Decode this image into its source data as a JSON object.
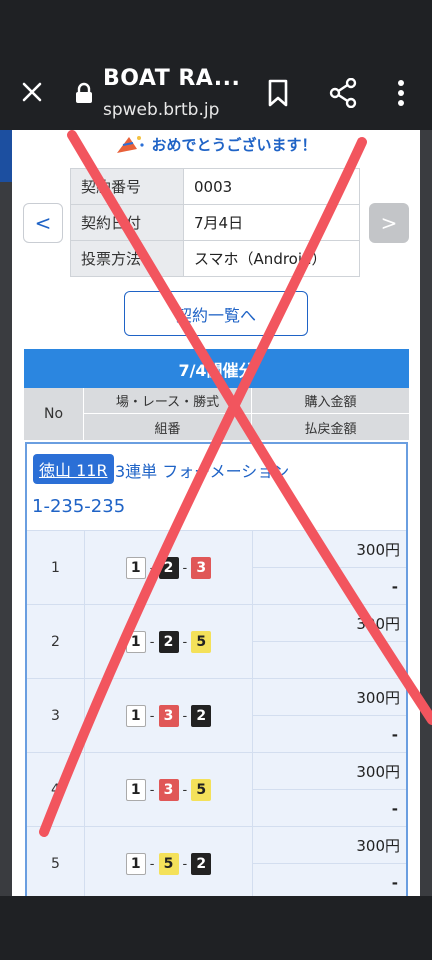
{
  "browser": {
    "title": "BOAT RA...",
    "url": "spweb.brtb.jp",
    "icons": [
      "close-icon",
      "lock-icon",
      "bookmark-icon",
      "share-icon",
      "more-vert-icon"
    ]
  },
  "congrats_text": "おめでとうございます！",
  "contract": {
    "rows": [
      {
        "label": "契約番号",
        "value": "0003"
      },
      {
        "label": "契約日付",
        "value": "7月4日"
      },
      {
        "label": "投票方法",
        "value": "スマホ（Android）"
      }
    ],
    "prev_label": "<",
    "next_label": ">"
  },
  "contract_list_button": "契約一覧へ",
  "day_header": "7/4開催分",
  "columns": {
    "no": "No",
    "race_info": "場・レース・勝式",
    "combo": "組番",
    "purchase": "購入金額",
    "payout": "払戻金額"
  },
  "race": {
    "tag": "徳山 11R",
    "bet_type": "3連単 フォーメーション",
    "formation": "1-235-235"
  },
  "bets": [
    {
      "no": "1",
      "boats": [
        "1",
        "2",
        "3"
      ],
      "amount": "300円",
      "payout": "-"
    },
    {
      "no": "2",
      "boats": [
        "1",
        "2",
        "5"
      ],
      "amount": "300円",
      "payout": "-"
    },
    {
      "no": "3",
      "boats": [
        "1",
        "3",
        "2"
      ],
      "amount": "300円",
      "payout": "-"
    },
    {
      "no": "4",
      "boats": [
        "1",
        "3",
        "5"
      ],
      "amount": "300円",
      "payout": "-"
    },
    {
      "no": "5",
      "boats": [
        "1",
        "5",
        "2"
      ],
      "amount": "300円",
      "payout": "-"
    }
  ],
  "colors": {
    "accent": "#1f63c6",
    "header_blue": "#2b86e0",
    "cross_red": "#f2555e"
  }
}
